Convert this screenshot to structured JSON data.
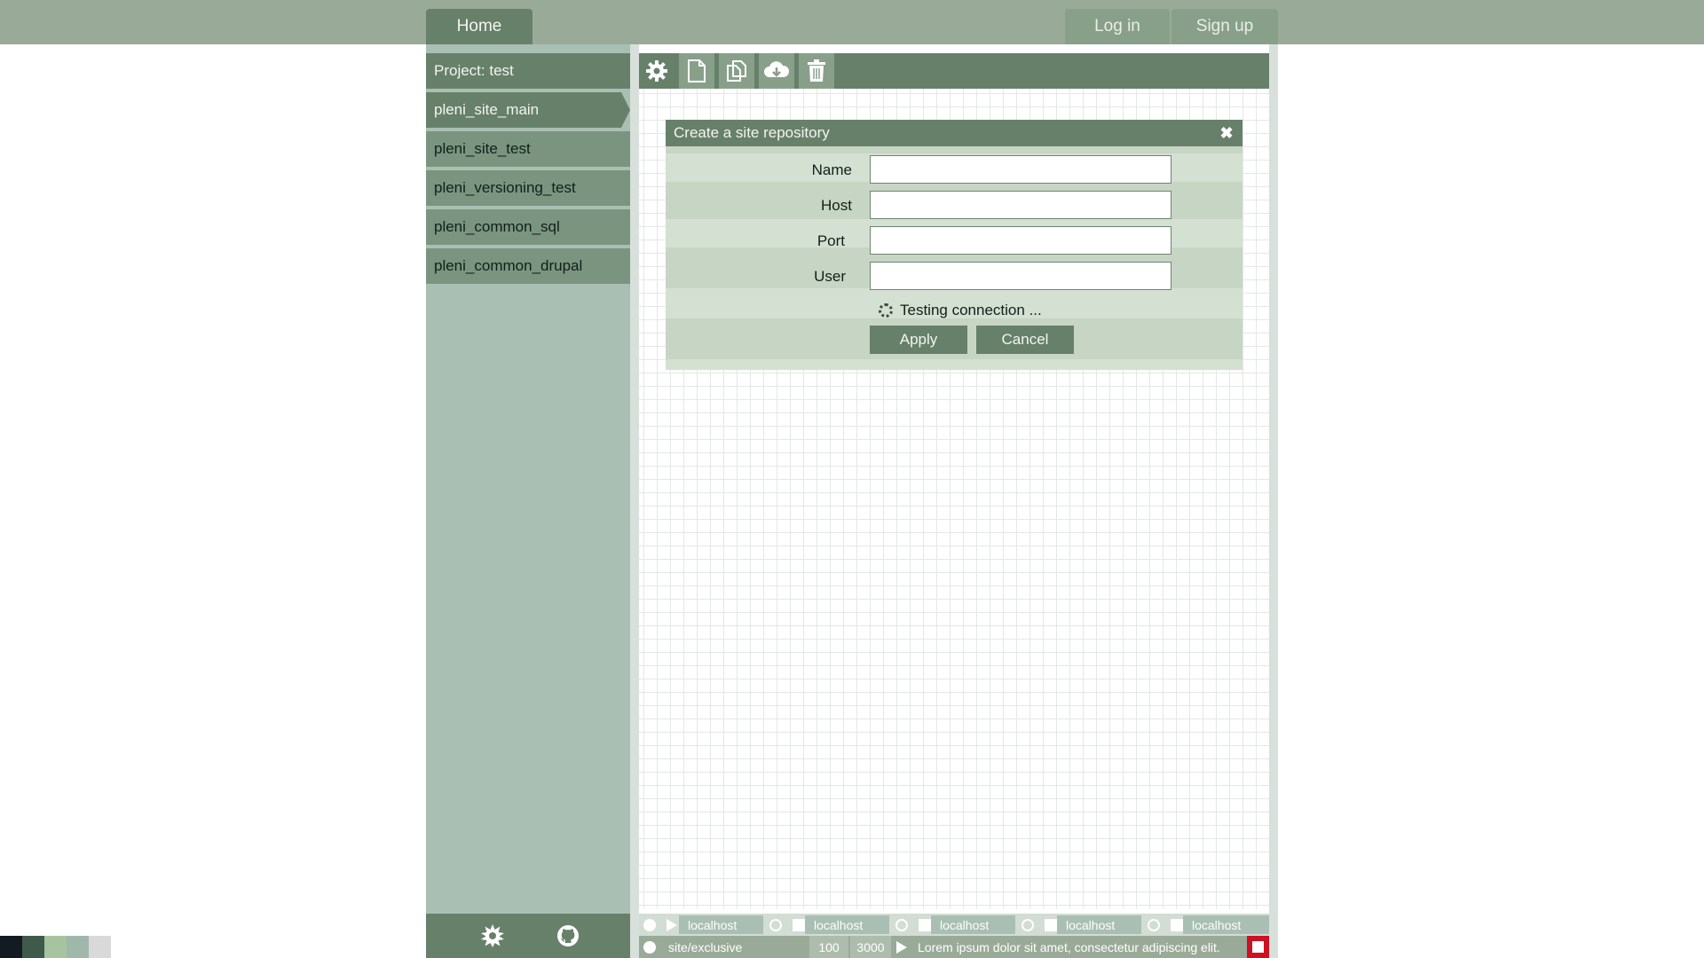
{
  "nav": {
    "home": "Home",
    "login": "Log in",
    "signup": "Sign up"
  },
  "project": {
    "title": "Project: test"
  },
  "sites": [
    "pleni_site_main",
    "pleni_site_test",
    "pleni_versioning_test",
    "pleni_common_sql",
    "pleni_common_drupal"
  ],
  "toolbar": {
    "icons": [
      "gear-icon",
      "new-file-icon",
      "copy-icon",
      "cloud-download-icon",
      "trash-icon"
    ]
  },
  "dialog": {
    "title": "Create a site repository",
    "close": "✖",
    "fields": [
      {
        "label": "Name",
        "value": ""
      },
      {
        "label": "Host",
        "value": ""
      },
      {
        "label": "Port",
        "value": ""
      },
      {
        "label": "User",
        "value": ""
      }
    ],
    "status": "Testing connection ...",
    "apply": "Apply",
    "cancel": "Cancel"
  },
  "statusbar": {
    "hosts": [
      "localhost",
      "localhost",
      "localhost",
      "localhost",
      "localhost"
    ],
    "path": "site/exclusive",
    "num1": "100",
    "num2": "3000",
    "message": "Lorem ipsum dolor sit amet, consectetur adipiscing elit."
  },
  "colors": {
    "accent": "#67806a",
    "sidebar": "#a9bfb3",
    "alert": "#cc1122"
  },
  "swatches": [
    "#141a22",
    "#3f5a4a",
    "#a7c39f",
    "#9fb8ab",
    "#d9d9d9"
  ]
}
